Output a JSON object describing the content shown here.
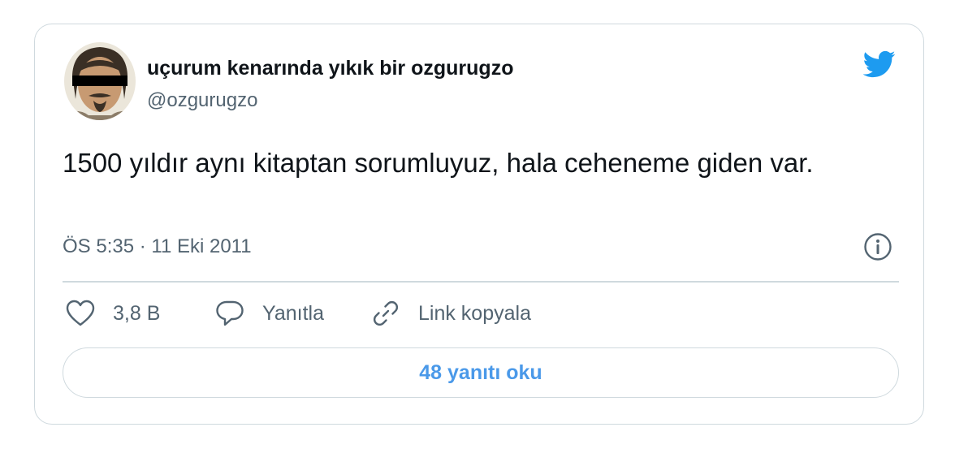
{
  "author": {
    "display_name": "uçurum kenarında yıkık bir ozgurugzo",
    "handle": "@ozgurugzo"
  },
  "tweet": {
    "text": "1500 yıldır aynı kitaptan sorumluyuz, hala ceheneme giden var.",
    "timestamp": "ÖS 5:35 · 11 Eki 2011"
  },
  "actions": {
    "like_count": "3,8 B",
    "reply_label": "Yanıtla",
    "copy_link_label": "Link kopyala"
  },
  "read_replies_label": "48 yanıtı oku",
  "icons": {
    "brand": "twitter-bird-icon",
    "info": "info-icon",
    "like": "heart-icon",
    "reply": "speech-bubble-icon",
    "copy": "link-icon"
  },
  "colors": {
    "brand_blue": "#1d9bf0",
    "link_blue": "#4a99e9",
    "text_primary": "#0f1419",
    "text_secondary": "#536471",
    "border": "#cfd9de"
  }
}
